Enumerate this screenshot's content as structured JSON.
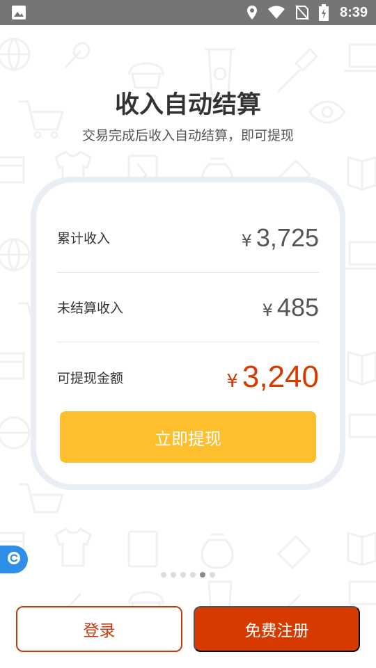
{
  "status_bar": {
    "time": "8:39",
    "icons": [
      "image-icon",
      "location-icon",
      "wifi-icon",
      "no-sim-icon",
      "battery-charging-icon"
    ]
  },
  "header": {
    "title": "收入自动结算",
    "subtitle": "交易完成后收入自动结算，即可提现"
  },
  "summary": {
    "rows": [
      {
        "label": "累计收入",
        "currency": "¥",
        "amount": "3,725"
      },
      {
        "label": "未结算收入",
        "currency": "¥",
        "amount": "485"
      },
      {
        "label": "可提现金额",
        "currency": "¥",
        "amount": "3,240"
      }
    ],
    "withdraw_label": "立即提现"
  },
  "pager": {
    "total": 6,
    "active_index": 4
  },
  "actions": {
    "login_label": "登录",
    "register_label": "免费注册"
  },
  "colors": {
    "accent": "#d63a00",
    "withdraw_button": "#fdbf2d",
    "status_bar": "#757575",
    "float_button": "#2f8ee8"
  }
}
